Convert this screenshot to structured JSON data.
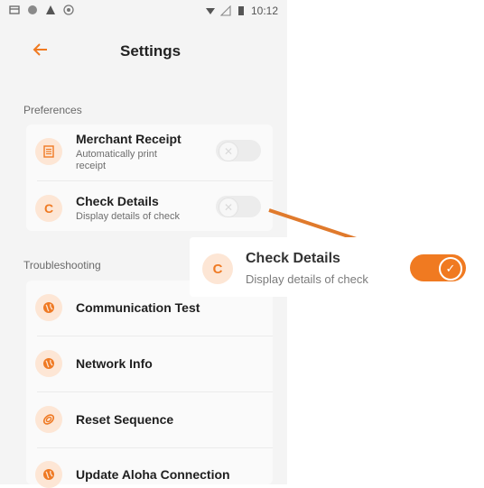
{
  "status_bar": {
    "time": "10:12",
    "left_icons": [
      "notification-icon",
      "circle-icon",
      "alert-icon",
      "sync-icon"
    ],
    "right_icons": [
      "wifi-icon",
      "signal-icon",
      "battery-icon"
    ]
  },
  "header": {
    "title": "Settings",
    "back_icon": "arrow-left-icon"
  },
  "sections": {
    "preferences": {
      "label": "Preferences",
      "items": [
        {
          "title": "Merchant Receipt",
          "subtitle_line1": "Automatically print",
          "subtitle_line2": "receipt",
          "icon": "receipt-icon",
          "toggle_on": false
        },
        {
          "title": "Check Details",
          "subtitle": "Display details of check",
          "badge": "C",
          "toggle_on": false
        }
      ]
    },
    "troubleshooting": {
      "label": "Troubleshooting",
      "items": [
        {
          "title": "Communication Test",
          "icon": "globe-icon"
        },
        {
          "title": "Network Info",
          "icon": "globe-icon"
        },
        {
          "title": "Reset Sequence",
          "icon": "reset-icon"
        },
        {
          "title": "Update Aloha Connection",
          "icon": "globe-icon"
        }
      ]
    }
  },
  "callout": {
    "title": "Check Details",
    "subtitle": "Display details of check",
    "badge": "C",
    "toggle_on": true
  },
  "colors": {
    "accent": "#f07a21",
    "avatar_bg": "#fde6d5",
    "background": "#f4f4f4"
  }
}
